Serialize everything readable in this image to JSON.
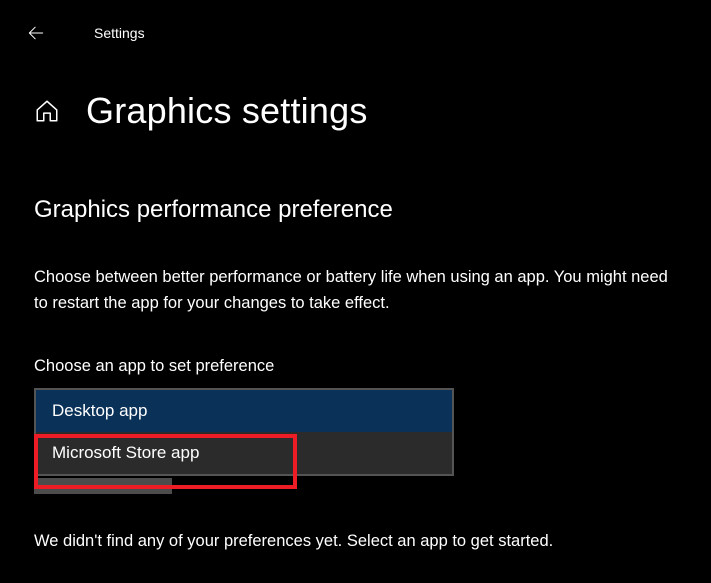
{
  "window": {
    "title": "Settings"
  },
  "page": {
    "heading": "Graphics settings"
  },
  "section": {
    "heading": "Graphics performance preference",
    "description": "Choose between better performance or battery life when using an app. You might need to restart the app for your changes to take effect.",
    "field_label": "Choose an app to set preference",
    "options": {
      "selected": "Desktop app",
      "other": "Microsoft Store app"
    },
    "empty_state": "We didn't find any of your preferences yet. Select an app to get started."
  }
}
